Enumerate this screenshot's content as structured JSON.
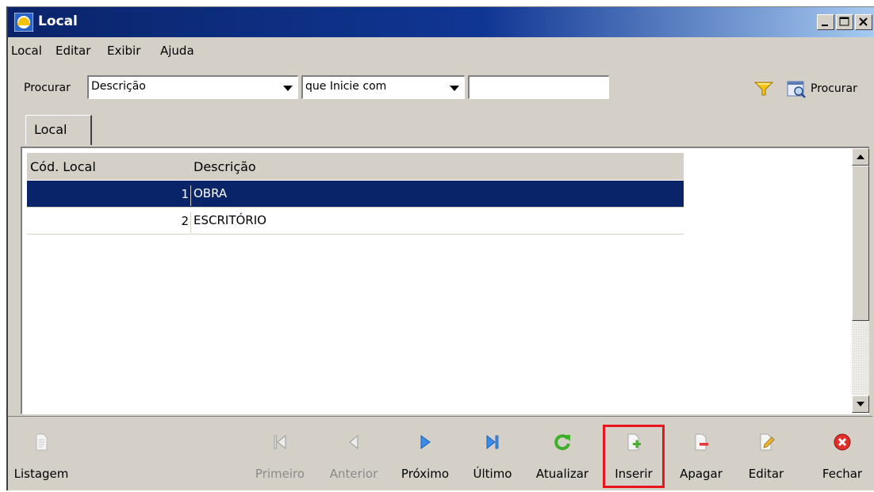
{
  "window": {
    "title": "Local"
  },
  "menu": [
    "Local",
    "Editar",
    "Exibir",
    "Ajuda"
  ],
  "search": {
    "label": "Procurar",
    "field_value": "Descrição",
    "operator_value": "que Inicie com",
    "text_value": "",
    "button_label": "Procurar"
  },
  "tabs": [
    {
      "label": "Local",
      "active": true
    }
  ],
  "table": {
    "columns": [
      "Cód. Local",
      "Descrição"
    ],
    "rows": [
      {
        "code": "1",
        "description": "OBRA",
        "selected": true
      },
      {
        "code": "2",
        "description": "ESCRITÓRIO",
        "selected": false
      }
    ]
  },
  "toolbar": {
    "listagem": {
      "label": "Listagem",
      "enabled": true,
      "icon": "document-icon"
    },
    "primeiro": {
      "label": "Primeiro",
      "enabled": false,
      "icon": "first-record-icon"
    },
    "anterior": {
      "label": "Anterior",
      "enabled": false,
      "icon": "previous-record-icon"
    },
    "proximo": {
      "label": "Próximo",
      "enabled": true,
      "icon": "next-record-icon"
    },
    "ultimo": {
      "label": "Último",
      "enabled": true,
      "icon": "last-record-icon"
    },
    "atualizar": {
      "label": "Atualizar",
      "enabled": true,
      "icon": "refresh-icon"
    },
    "inserir": {
      "label": "Inserir",
      "enabled": true,
      "icon": "insert-icon",
      "highlighted": true
    },
    "apagar": {
      "label": "Apagar",
      "enabled": true,
      "icon": "delete-icon"
    },
    "editar": {
      "label": "Editar",
      "enabled": true,
      "icon": "edit-icon"
    },
    "fechar": {
      "label": "Fechar",
      "enabled": true,
      "icon": "close-icon"
    }
  },
  "colors": {
    "title_bar": "#0a246a",
    "selection": "#0a246a",
    "highlight_border": "#e8141e",
    "window_face": "#d4d0c8"
  }
}
